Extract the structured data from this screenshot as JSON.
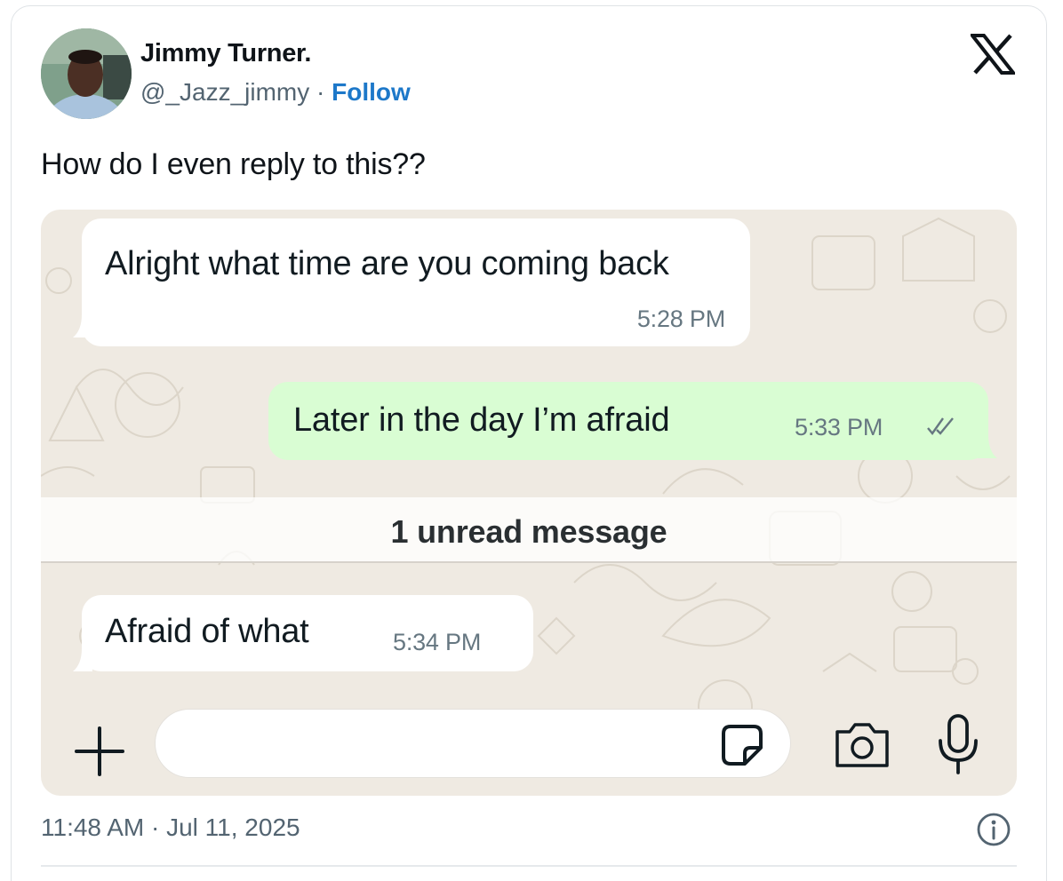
{
  "author": {
    "name": "Jimmy Turner.",
    "handle": "@_Jazz_jimmy",
    "separator": "·",
    "follow_label": "Follow",
    "avatar_icon": "profile-photo"
  },
  "tweet": {
    "text": "How do I even reply to this??",
    "timestamp": "11:48 AM · Jul 11, 2025"
  },
  "chat": {
    "messages": [
      {
        "direction": "incoming",
        "text": "Alright what time are you coming back",
        "time": "5:28 PM"
      },
      {
        "direction": "outgoing",
        "text": "Later in the day I’m afraid",
        "time": "5:33 PM",
        "status_icon": "double-check-icon"
      },
      {
        "direction": "incoming",
        "text": "Afraid of what",
        "time": "5:34 PM"
      }
    ],
    "unread_label": "1 unread message",
    "input": {
      "value": "",
      "placeholder": ""
    },
    "icons": [
      "plus-icon",
      "sticker-icon",
      "camera-icon",
      "microphone-icon"
    ]
  },
  "colors": {
    "follow_blue": "#1d78c9",
    "outgoing_bubble": "#d9fdd3",
    "incoming_bubble": "#ffffff",
    "chat_background": "#efeae2"
  }
}
